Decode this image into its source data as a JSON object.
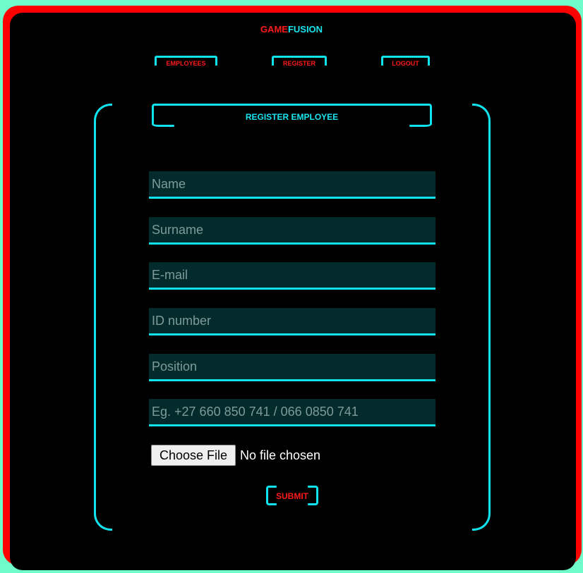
{
  "brand": {
    "part1": "GAME",
    "part2": "FUSION"
  },
  "nav": {
    "employees": "EMPLOYEES",
    "register": "REGISTER",
    "logout": "LOGOUT"
  },
  "form": {
    "title": "REGISTER EMPLOYEE",
    "fields": [
      {
        "placeholder": "Name",
        "value": ""
      },
      {
        "placeholder": "Surname",
        "value": ""
      },
      {
        "placeholder": "E-mail",
        "value": ""
      },
      {
        "placeholder": "ID number",
        "value": ""
      },
      {
        "placeholder": "Position",
        "value": ""
      },
      {
        "placeholder": "Eg. +27 660 850 741 / 066 0850 741",
        "value": ""
      }
    ],
    "file_button": "Choose File",
    "file_status": "No file chosen",
    "submit": "SUBMIT"
  },
  "colors": {
    "background": "#000000",
    "accent": "#11e3ee",
    "brand_red": "#ff1a1a",
    "field_bg": "#032b2b",
    "outer": "#6ffcc9"
  }
}
